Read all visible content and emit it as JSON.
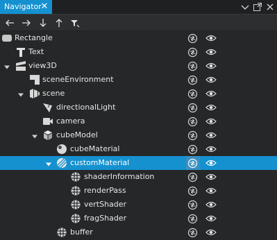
{
  "panel": {
    "title": "Navigator"
  },
  "toolbar": {
    "buttons": [
      "arrow-left-icon",
      "arrow-right-icon",
      "arrow-down-icon",
      "arrow-up-icon",
      "filter-icon"
    ]
  },
  "tree": [
    {
      "label": "Rectangle",
      "icon": "rectangle-icon",
      "level": 0,
      "expandable": false,
      "selected": false
    },
    {
      "label": "Text",
      "icon": "text-icon",
      "level": 1,
      "expandable": false,
      "selected": false
    },
    {
      "label": "view3D",
      "icon": "view3d-icon",
      "level": 1,
      "expandable": true,
      "expanded": true,
      "selected": false
    },
    {
      "label": "sceneEnvironment",
      "icon": "scene-environment-icon",
      "level": 2,
      "expandable": false,
      "selected": false
    },
    {
      "label": "scene",
      "icon": "scene-icon",
      "level": 2,
      "expandable": true,
      "expanded": true,
      "selected": false
    },
    {
      "label": "directionalLight",
      "icon": "directional-light-icon",
      "level": 3,
      "expandable": false,
      "selected": false
    },
    {
      "label": "camera",
      "icon": "camera-icon",
      "level": 3,
      "expandable": false,
      "selected": false
    },
    {
      "label": "cubeModel",
      "icon": "model-icon",
      "level": 3,
      "expandable": true,
      "expanded": true,
      "selected": false
    },
    {
      "label": "cubeMaterial",
      "icon": "material-icon",
      "level": 4,
      "expandable": false,
      "selected": false
    },
    {
      "label": "customMaterial",
      "icon": "custom-material-icon",
      "level": 4,
      "expandable": true,
      "expanded": true,
      "selected": true
    },
    {
      "label": "shaderInformation",
      "icon": "shader-icon",
      "level": 5,
      "expandable": false,
      "selected": false
    },
    {
      "label": "renderPass",
      "icon": "shader-icon",
      "level": 5,
      "expandable": false,
      "selected": false
    },
    {
      "label": "vertShader",
      "icon": "shader-icon",
      "level": 5,
      "expandable": false,
      "selected": false
    },
    {
      "label": "fragShader",
      "icon": "shader-icon",
      "level": 5,
      "expandable": false,
      "selected": false
    },
    {
      "label": "buffer",
      "icon": "shader-icon",
      "level": 4,
      "expandable": false,
      "selected": false
    }
  ],
  "colors": {
    "selection": "#1591d0",
    "background": "#262728",
    "text": "#e6e6e6"
  }
}
